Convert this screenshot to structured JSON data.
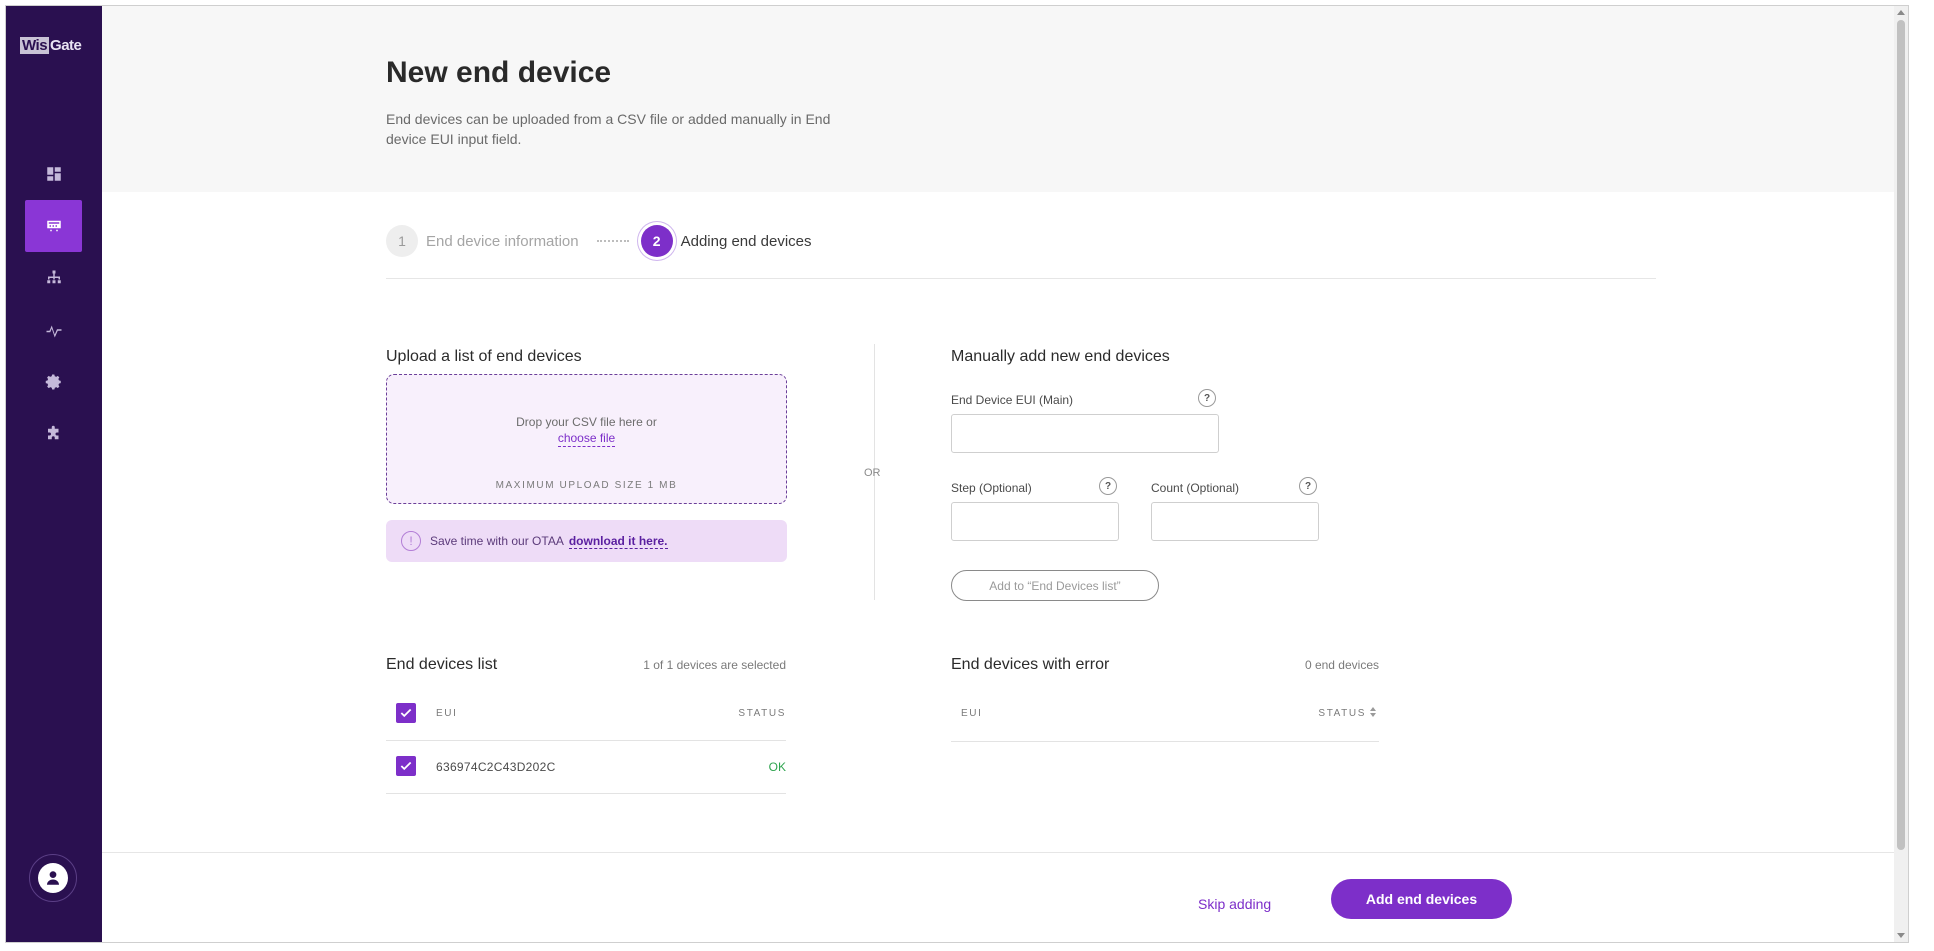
{
  "app": {
    "logo_box": "Wis",
    "logo_rest": "Gate"
  },
  "sidebar": {
    "items": [
      {
        "icon": "dashboard-icon"
      },
      {
        "icon": "end-devices-icon",
        "active": true
      },
      {
        "icon": "network-icon"
      },
      {
        "icon": "activity-icon"
      },
      {
        "icon": "settings-icon"
      },
      {
        "icon": "extensions-icon"
      }
    ],
    "accent": "#8a36d6",
    "background": "#2a1050"
  },
  "header": {
    "title": "New end device",
    "description": "End devices can be uploaded from a CSV file or added manually in End device EUI input field."
  },
  "stepper": {
    "step1_number": "1",
    "step1_label": "End device information",
    "step2_number": "2",
    "step2_label": "Adding end devices"
  },
  "upload": {
    "title": "Upload a list of end devices",
    "drop_text": "Drop your CSV file here or",
    "choose_link": "choose file",
    "max_size": "MAXIMUM UPLOAD SIZE 1 MB",
    "otaa_text": "Save time with our OTAA",
    "otaa_link": "download it here."
  },
  "separator": {
    "or": "OR"
  },
  "manual": {
    "title": "Manually add new end devices",
    "eui_label": "End Device EUI (Main)",
    "step_label": "Step (Optional)",
    "count_label": "Count (Optional)",
    "help": "?",
    "add_button": "Add to “End Devices list”"
  },
  "devices_list": {
    "title": "End devices list",
    "selected_text": "1 of 1 devices are selected",
    "col_eui": "EUI",
    "col_status": "STATUS",
    "rows": [
      {
        "eui": "636974C2C43D202C",
        "status": "OK"
      }
    ]
  },
  "error_list": {
    "title": "End devices with error",
    "count_text": "0 end devices",
    "col_eui": "EUI",
    "col_status": "STATUS"
  },
  "footer": {
    "skip": "Skip adding",
    "primary": "Add end devices"
  },
  "colors": {
    "primary": "#7d2fc9",
    "ok": "#2fa44f"
  }
}
